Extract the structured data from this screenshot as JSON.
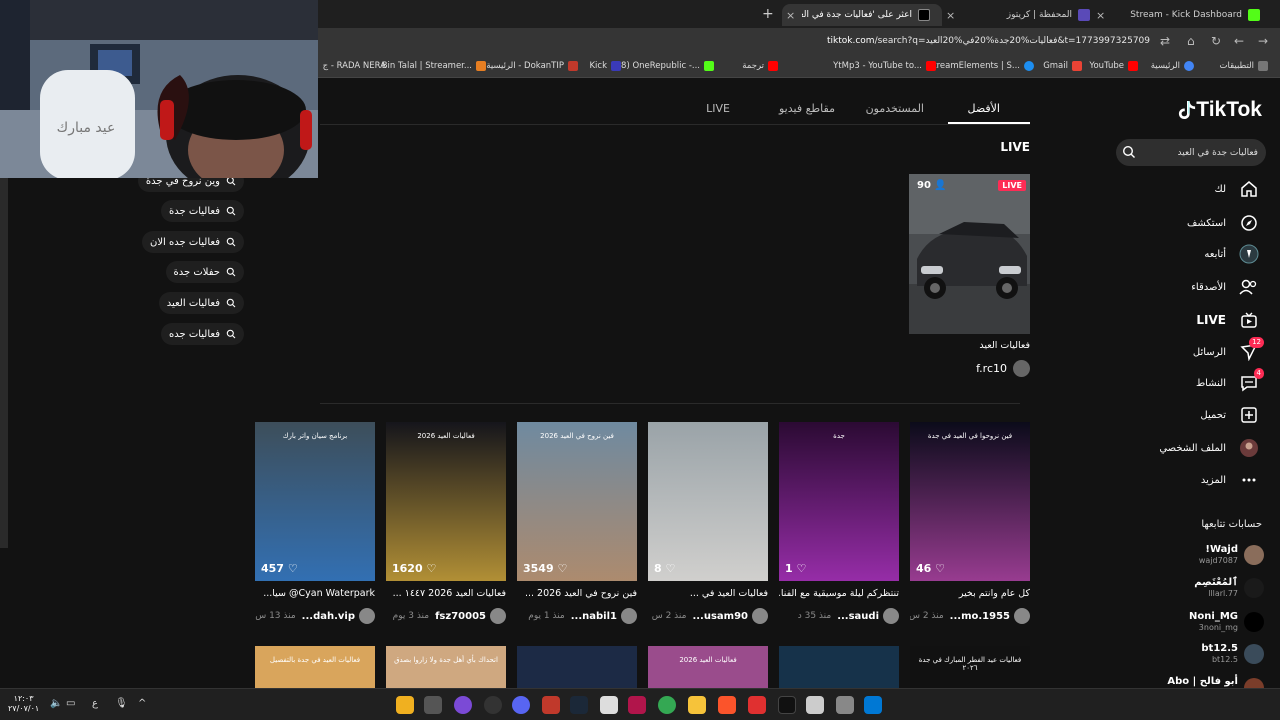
{
  "browser": {
    "tabs": [
      {
        "title": "Stream - Kick Dashboard",
        "active": false
      },
      {
        "title": "المحفظة | كريتوز",
        "active": false
      },
      {
        "title": "اعثر على 'فعاليات جدة في العيد'",
        "active": true
      }
    ],
    "url_host": "tiktok.com",
    "url_path": "/search?q=فعاليات%20جدة%20في%20العيد&t=1773997325709",
    "bookmarks": [
      "التطبيقات",
      "الرئيسية",
      "YouTube",
      "Gmail",
      "StreamElements | S...",
      "YtMp3 - YouTube to...",
      "ترجمة",
      "(18) OneRepublic -...",
      "Kick",
      "الرئيسية - DokanTIP",
      "Bin Talal | Streamer...",
      "ج - RADA NERA"
    ]
  },
  "tiktok": {
    "logo": "TikTok",
    "search_value": "فعاليات جدة في العيد",
    "nav": [
      {
        "label": "لك",
        "icon": "home-icon"
      },
      {
        "label": "استكشف",
        "icon": "compass-icon"
      },
      {
        "label": "أتابعه",
        "icon": "following-icon"
      },
      {
        "label": "الأصدقاء",
        "icon": "friends-icon"
      },
      {
        "label": "LIVE",
        "icon": "live-tv-icon"
      },
      {
        "label": "الرسائل",
        "icon": "messages-icon",
        "badge": "12"
      },
      {
        "label": "النشاط",
        "icon": "activity-icon",
        "badge": "4"
      },
      {
        "label": "تحميل",
        "icon": "upload-icon"
      },
      {
        "label": "الملف الشخصي",
        "icon": "profile-icon"
      },
      {
        "label": "المزيد",
        "icon": "more-icon"
      }
    ],
    "following_title": "حسابات تتابعها",
    "following": [
      {
        "name": "Wajd!",
        "handle": "wajd7087"
      },
      {
        "name": "ٱلمُعْتَصِم",
        "handle": "lllarl.77"
      },
      {
        "name": "Noni_MG",
        "handle": "3noni_mg"
      },
      {
        "name": "bt12.5",
        "handle": "bt12.5"
      },
      {
        "name": "أبو فالح | Abo faleh",
        "handle": ""
      }
    ],
    "search_tabs": [
      "الأفضل",
      "المستخدمون",
      "مقاطع فيديو",
      "LIVE"
    ],
    "live_section": {
      "heading": "LIVE",
      "badge": "LIVE",
      "viewers": "90",
      "title": "فعاليات العيد",
      "user": "f.rc10"
    },
    "suggestions": [
      "وين نروح في جدة",
      "فعاليات جدة",
      "فعاليات جده الان",
      "حفلات جدة",
      "فعاليات العيد",
      "فعاليات جده"
    ],
    "videos": [
      {
        "views": "46",
        "overlay": "فين نروحوا في العيد في جدة",
        "title": "كل عام وانتم بخير",
        "user": "mo.1955...",
        "time": "منذ 2 س",
        "bg": "#0b0b1a",
        "accent": "#d04fbf"
      },
      {
        "views": "1",
        "overlay": "جدة",
        "title": "تنتظركم ليلة موسيقية مع الفنا...",
        "user": "saudi...",
        "time": "منذ 35 د",
        "bg": "#2b0a33",
        "accent": "#c13bd6"
      },
      {
        "views": "8",
        "overlay": "",
        "title": "فعاليات العيد في ...",
        "user": "usam90...",
        "time": "منذ 2 س",
        "bg": "#9aa3a8",
        "accent": "#e6e1dc"
      },
      {
        "views": "3549",
        "overlay": "فين نروح في العيد 2026",
        "title": "فين نروح في العيد 2026 ...",
        "user": "nabil1...",
        "time": "منذ 1 يوم",
        "bg": "#6f8aa0",
        "accent": "#c58b5a"
      },
      {
        "views": "1620",
        "overlay": "فعاليات العيد 2026",
        "title": "فعاليات العيد 2026 ١٤٤٧ ...",
        "user": "fsz70005",
        "time": "منذ 3 يوم",
        "bg": "#15151b",
        "accent": "#f0c040"
      },
      {
        "views": "457",
        "overlay": "برنامج سيان واتر بارك",
        "title": "Cyan Waterpark@ سيا...",
        "user": "dah.vip...",
        "time": "منذ 13 س",
        "bg": "#3d4e5a",
        "accent": "#2e7dd6"
      }
    ],
    "videos_row2": [
      {
        "overlay": "فعاليات عيد الفطر المبارك في جدة ٢٠٢٦",
        "bg": "#111111"
      },
      {
        "overlay": "",
        "bg": "#16324a"
      },
      {
        "overlay": "فعاليات العيد 2026",
        "bg": "#9a4c8c"
      },
      {
        "overlay": "",
        "bg": "#1c2a45"
      },
      {
        "overlay": "اتحداك بأي أهل جدة ولا زاروا بصدق",
        "bg": "#cfa880"
      },
      {
        "overlay": "فعاليات العيد في جدة بالتفصيل",
        "bg": "#d9a55c"
      }
    ]
  },
  "taskbar": {
    "time": "١٢:٠٣",
    "date": "٢٧/٠٧/٠١",
    "lang": "ع"
  }
}
